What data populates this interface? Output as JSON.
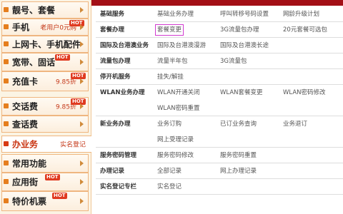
{
  "sidebar": {
    "items": [
      {
        "label": "靓号、套餐",
        "note": "",
        "hot": ""
      },
      {
        "label": "手机",
        "note": "老用户0元购",
        "hot": "HOT"
      },
      {
        "label": "上网卡、手机配件",
        "note": "",
        "hot": ""
      },
      {
        "label": "宽带、固话",
        "note": "",
        "hot": "HOT"
      },
      {
        "label": "充值卡",
        "note": "9.85折",
        "hot": "HOT"
      },
      {
        "label": "交话费",
        "note": "9.85折",
        "hot": "HOT"
      },
      {
        "label": "查话费",
        "note": "",
        "hot": ""
      },
      {
        "label": "办业务",
        "note": "实名登记",
        "hot": ""
      },
      {
        "label": "常用功能",
        "note": "",
        "hot": ""
      },
      {
        "label": "应用街",
        "note": "",
        "hot": "HOT"
      },
      {
        "label": "特价机票",
        "note": "",
        "hot": "HOT"
      }
    ]
  },
  "services": {
    "rows": [
      {
        "category": "基础服务",
        "options": [
          "基础业务办理",
          "呼叫转移号码设置",
          "网龄升级计划"
        ]
      },
      {
        "category": "套餐办理",
        "options": [
          "套餐变更",
          "3G流量包办理",
          "20元套餐可选包"
        ]
      },
      {
        "category": "国际及台港澳业务",
        "options": [
          "国际及台港澳漫游",
          "国际及台港澳长途",
          ""
        ]
      },
      {
        "category": "流量包办理",
        "options": [
          "流量半年包",
          "3G流量包",
          ""
        ]
      },
      {
        "category": "停开机服务",
        "options": [
          "挂失/解挂",
          "",
          ""
        ]
      },
      {
        "category": "WLAN业务办理",
        "options": [
          "WLAN开通关闭",
          "WLAN套餐变更",
          "WLAN密码修改"
        ]
      },
      {
        "category": "",
        "options": [
          "WLAN密码重置",
          "",
          ""
        ]
      },
      {
        "category": "新业务办理",
        "options": [
          "业务订购",
          "已订业务查询",
          "业务退订"
        ]
      },
      {
        "category": "",
        "options": [
          "网上受理记录",
          "",
          ""
        ]
      },
      {
        "category": "服务密码管理",
        "options": [
          "服务密码修改",
          "服务密码重置",
          ""
        ]
      },
      {
        "category": "办理记录",
        "options": [
          "全部记录",
          "网上办理记录",
          ""
        ]
      },
      {
        "category": "实名登记专栏",
        "options": [
          "实名登记",
          "",
          ""
        ]
      }
    ]
  },
  "colors": {
    "accent": "#e57e1e",
    "banner": "#a30f16",
    "highlight": "#d13ad0",
    "active_text": "#c8320f"
  }
}
